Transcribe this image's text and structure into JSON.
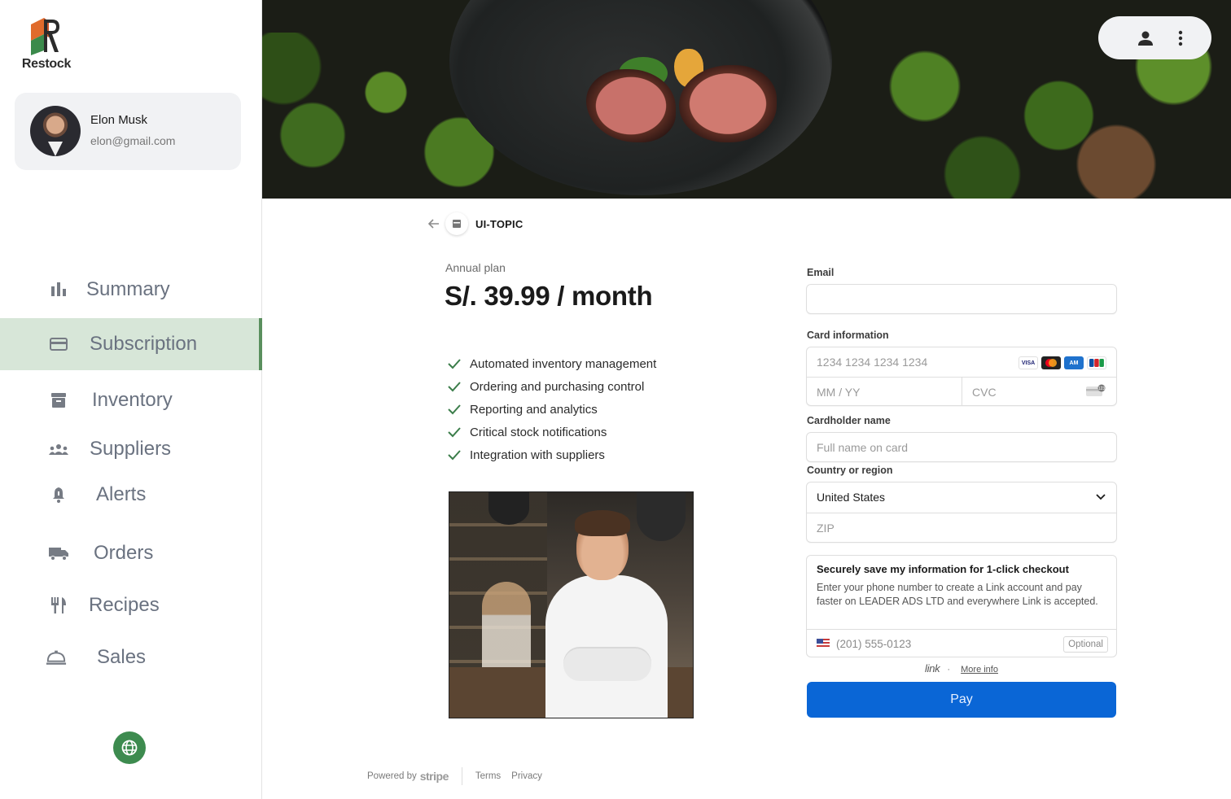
{
  "app": {
    "name": "Restock"
  },
  "user": {
    "name": "Elon Musk",
    "email": "elon@gmail.com"
  },
  "nav": {
    "items": [
      {
        "label": "Summary",
        "icon": "bar-chart-icon"
      },
      {
        "label": "Subscription",
        "icon": "credit-card-icon",
        "active": true
      },
      {
        "label": "Inventory",
        "icon": "archive-icon"
      },
      {
        "label": "Suppliers",
        "icon": "groups-icon"
      },
      {
        "label": "Alerts",
        "icon": "bell-icon"
      },
      {
        "label": "Orders",
        "icon": "truck-icon"
      },
      {
        "label": "Recipes",
        "icon": "utensils-icon"
      },
      {
        "label": "Sales",
        "icon": "service-bell-icon"
      }
    ],
    "active_color": "#d7e6d8",
    "active_bar_color": "#5a8f5e"
  },
  "language_button": {
    "icon": "globe-icon",
    "color": "#3d8b4f"
  },
  "header_actions": {
    "account_icon": "person-icon",
    "menu_icon": "more-vertical-icon"
  },
  "checkout": {
    "business_name": "UI-TOPIC",
    "plan_label": "Annual plan",
    "price": "S/. 39.99 / month",
    "features": [
      "Automated inventory management",
      "Ordering and purchasing control",
      "Reporting and analytics",
      "Critical stock notifications",
      "Integration with suppliers"
    ],
    "accent_color": "#3b7d4a"
  },
  "form": {
    "email_label": "Email",
    "email_value": "",
    "card_label": "Card information",
    "card_number_placeholder": "1234 1234 1234 1234",
    "card_brands": [
      "VISA",
      "MC",
      "AMEX",
      "JCB"
    ],
    "expiry_placeholder": "MM / YY",
    "cvc_placeholder": "CVC",
    "cardholder_label": "Cardholder name",
    "cardholder_placeholder": "Full name on card",
    "country_label": "Country or region",
    "country_value": "United States",
    "zip_placeholder": "ZIP",
    "link_title": "Securely save my information for 1-click checkout",
    "link_description": "Enter your phone number to create a Link account and pay faster on LEADER ADS LTD and everywhere Link is accepted.",
    "phone_placeholder": "(201) 555-0123",
    "optional_label": "Optional",
    "link_brand": "link",
    "more_info": "More info",
    "pay_label": "Pay",
    "pay_color": "#0a66d6"
  },
  "footer": {
    "powered_by": "Powered by",
    "brand": "stripe",
    "terms": "Terms",
    "privacy": "Privacy"
  }
}
